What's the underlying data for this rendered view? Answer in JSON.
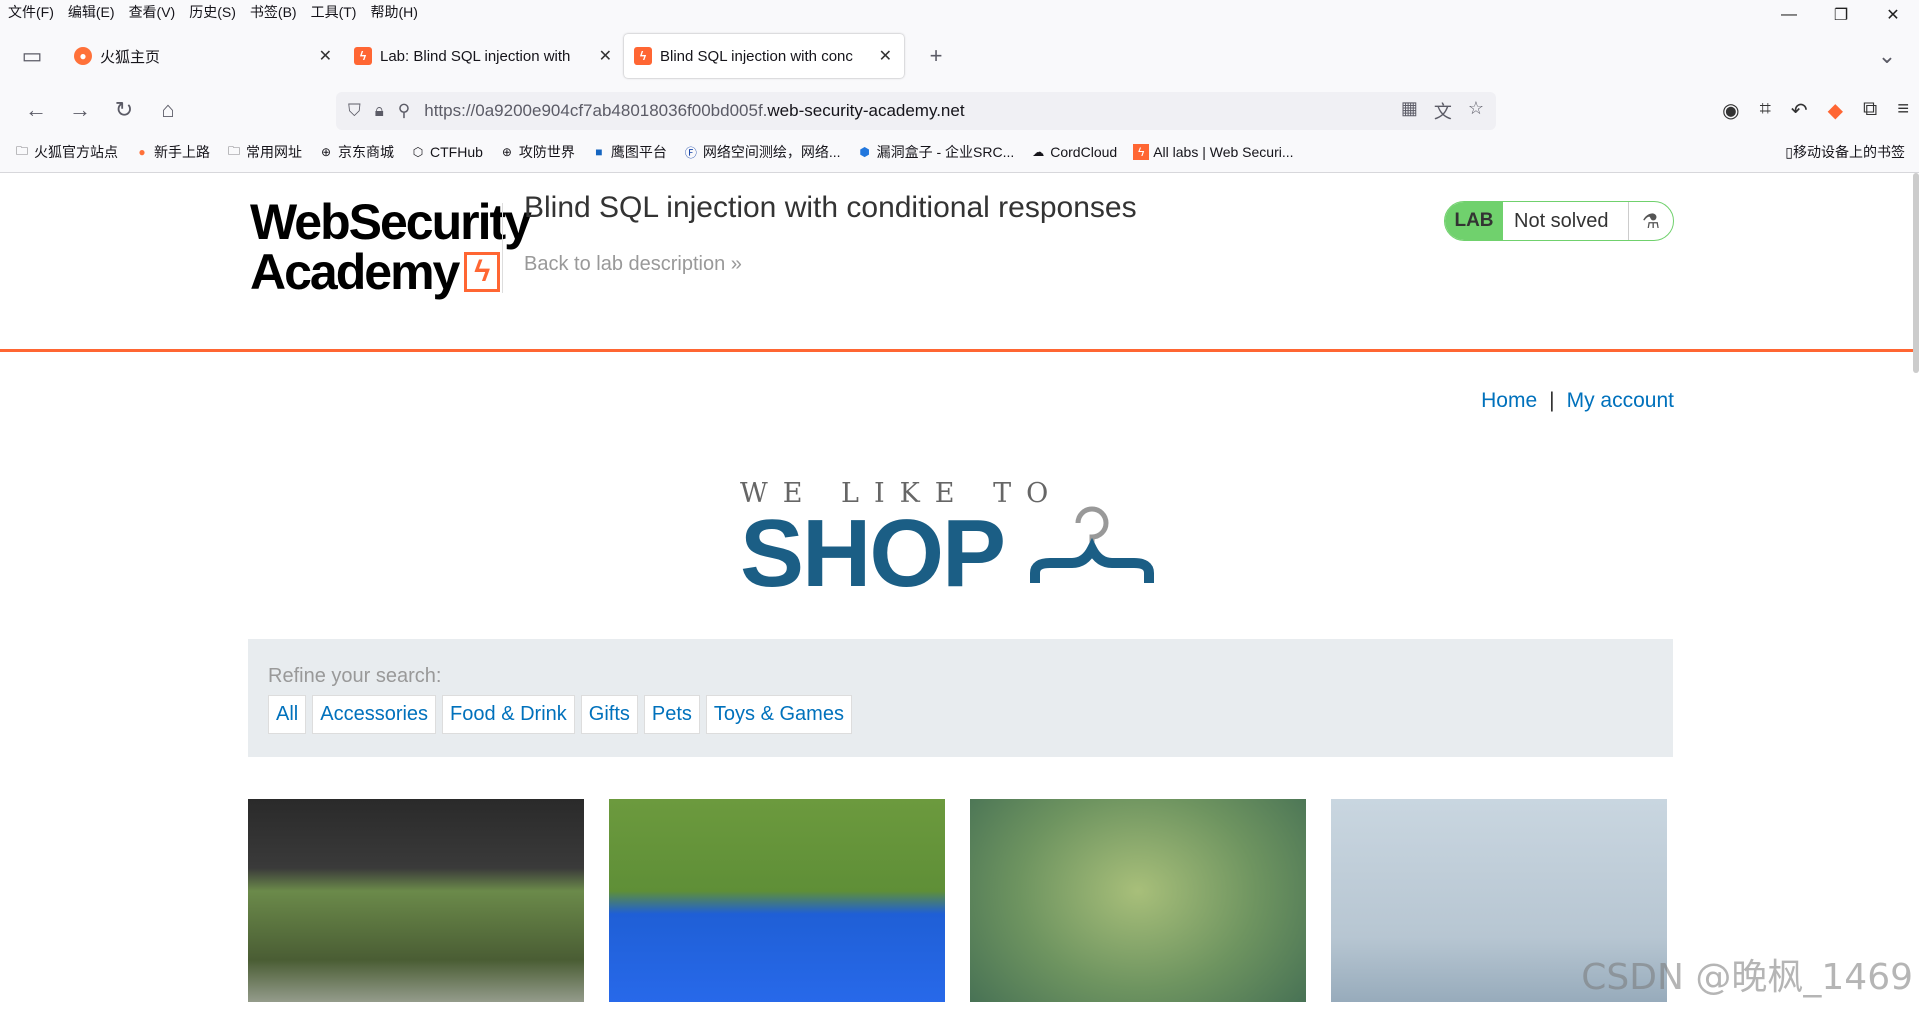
{
  "menubar": [
    "文件(F)",
    "编辑(E)",
    "查看(V)",
    "历史(S)",
    "书签(B)",
    "工具(T)",
    "帮助(H)"
  ],
  "window_controls": {
    "minimize": "—",
    "restore": "❐",
    "close": "✕"
  },
  "tabs": [
    {
      "label": "火狐主页",
      "icon": "firefox-icon",
      "active": false
    },
    {
      "label": "Lab: Blind SQL injection with",
      "icon": "portswigger-icon",
      "active": false
    },
    {
      "label": "Blind SQL injection with conc",
      "icon": "portswigger-icon",
      "active": true
    }
  ],
  "new_tab": "+",
  "url": {
    "prefix": "https://0a9200e904cf7ab48018036f00bd005f.",
    "host": "web-security-academy.net"
  },
  "bookmarks": [
    {
      "label": "火狐官方站点",
      "icon": "folder-icon"
    },
    {
      "label": "新手上路",
      "icon": "firefox-icon"
    },
    {
      "label": "常用网址",
      "icon": "folder-icon"
    },
    {
      "label": "京东商城",
      "icon": "globe-icon"
    },
    {
      "label": "CTFHub",
      "icon": "ctfhub-icon"
    },
    {
      "label": "攻防世界",
      "icon": "globe-icon"
    },
    {
      "label": "鹰图平台",
      "icon": "hunter-icon"
    },
    {
      "label": "网络空间测绘，网络...",
      "icon": "fofa-icon"
    },
    {
      "label": "漏洞盒子 - 企业SRC...",
      "icon": "vulbox-icon"
    },
    {
      "label": "CordCloud",
      "icon": "cordcloud-icon"
    },
    {
      "label": "All labs | Web Securi...",
      "icon": "portswigger-icon"
    }
  ],
  "bookmark_mobile": "移动设备上的书签",
  "lab": {
    "logo_line1": "WebSecurity",
    "logo_line2": "Academy",
    "title": "Blind SQL injection with conditional responses",
    "back_link": "Back to lab description",
    "status_badge": "LAB",
    "status_text": "Not solved"
  },
  "nav": {
    "home": "Home",
    "separator": "|",
    "account": "My account"
  },
  "banner": {
    "line1": "WE LIKE TO",
    "line2": "SHOP"
  },
  "filter": {
    "label": "Refine your search:",
    "categories": [
      "All",
      "Accessories",
      "Food & Drink",
      "Gifts",
      "Pets",
      "Toys & Games"
    ]
  },
  "watermark": "CSDN @晚枫_1469"
}
